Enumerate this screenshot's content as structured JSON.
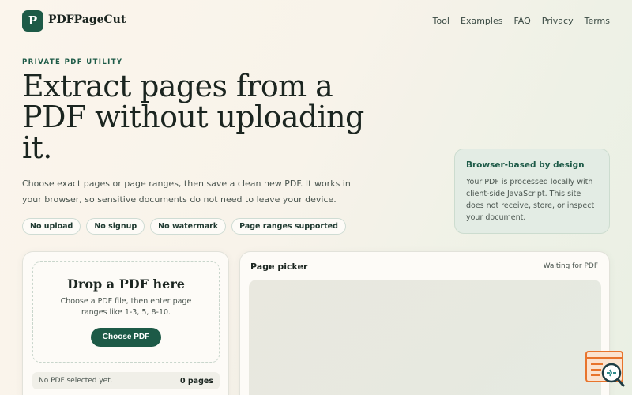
{
  "header": {
    "logo_letter": "P",
    "brand": "PDFPageCut",
    "nav": [
      "Tool",
      "Examples",
      "FAQ",
      "Privacy",
      "Terms"
    ]
  },
  "hero": {
    "eyebrow": "PRIVATE PDF UTILITY",
    "headline": "Extract pages from a PDF without uploading it.",
    "lede": "Choose exact pages or page ranges, then save a clean new PDF. It works in your browser, so sensitive documents do not need to leave your device.",
    "pills": [
      "No upload",
      "No signup",
      "No watermark",
      "Page ranges supported"
    ]
  },
  "info_card": {
    "title": "Browser-based by design",
    "text": "Your PDF is processed locally with client-side JavaScript. This site does not receive, store, or inspect your document."
  },
  "upload": {
    "title": "Drop a PDF here",
    "help": "Choose a PDF file, then enter page ranges like 1-3, 5, 8-10.",
    "button": "Choose PDF",
    "status": "No PDF selected yet.",
    "page_count": "0 pages"
  },
  "picker": {
    "title": "Page picker",
    "status": "Waiting for PDF"
  },
  "colors": {
    "accent": "#1d5a47",
    "background": "#f8f3ea",
    "info_card_bg": "#e3ece4",
    "widget_orange": "#e8742c"
  },
  "icons": {
    "widget": "search-list-icon"
  }
}
